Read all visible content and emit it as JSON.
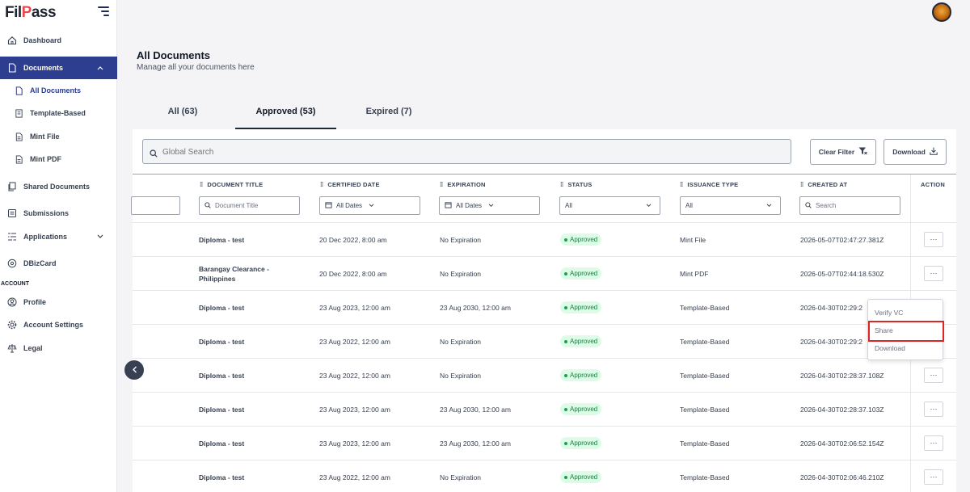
{
  "app": {
    "logo_text_1": "Fil",
    "logo_text_2": "P",
    "logo_text_3": "ass"
  },
  "sidebar": {
    "dashboard": "Dashboard",
    "documents": "Documents",
    "sub": [
      "All Documents",
      "Template-Based",
      "Mint File",
      "Mint PDF"
    ],
    "shared": "Shared Documents",
    "submissions": "Submissions",
    "applications": "Applications",
    "dbizcard": "DBizCard",
    "account_section": "ACCOUNT",
    "profile": "Profile",
    "account_settings": "Account Settings",
    "legal": "Legal"
  },
  "header": {
    "title": "All Documents",
    "subtitle": "Manage all your documents here"
  },
  "tabs": [
    {
      "label": "All (63)"
    },
    {
      "label": "Approved (53)"
    },
    {
      "label": "Expired (7)"
    }
  ],
  "toolbar": {
    "search_placeholder": "Global Search",
    "clear_filter": "Clear Filter",
    "download": "Download"
  },
  "columns": {
    "document_title": "DOCUMENT TITLE",
    "certified_date": "CERTIFIED DATE",
    "expiration": "EXPIRATION",
    "status": "STATUS",
    "issuance_type": "ISSUANCE TYPE",
    "created_at": "CREATED AT",
    "action": "ACTION"
  },
  "filters": {
    "document_title_placeholder": "Document Title",
    "certified_date": "All Dates",
    "expiration": "All Dates",
    "status": "All",
    "issuance_type": "All",
    "created_at_placeholder": "Search"
  },
  "rows": [
    {
      "title": "Diploma - test",
      "certified": "20 Dec 2022, 8:00 am",
      "expiration": "No Expiration",
      "status": "Approved",
      "type": "Mint File",
      "created": "2026-05-07T02:47:27.381Z"
    },
    {
      "title": "Barangay Clearance - Philippines",
      "certified": "20 Dec 2022, 8:00 am",
      "expiration": "No Expiration",
      "status": "Approved",
      "type": "Mint PDF",
      "created": "2026-05-07T02:44:18.530Z"
    },
    {
      "title": "Diploma - test",
      "certified": "23 Aug 2023, 12:00 am",
      "expiration": "23 Aug 2030, 12:00 am",
      "status": "Approved",
      "type": "Template-Based",
      "created": "2026-04-30T02:29:2"
    },
    {
      "title": "Diploma - test",
      "certified": "23 Aug 2022, 12:00 am",
      "expiration": "No Expiration",
      "status": "Approved",
      "type": "Template-Based",
      "created": "2026-04-30T02:29:2"
    },
    {
      "title": "Diploma - test",
      "certified": "23 Aug 2022, 12:00 am",
      "expiration": "No Expiration",
      "status": "Approved",
      "type": "Template-Based",
      "created": "2026-04-30T02:28:37.108Z"
    },
    {
      "title": "Diploma - test",
      "certified": "23 Aug 2023, 12:00 am",
      "expiration": "23 Aug 2030, 12:00 am",
      "status": "Approved",
      "type": "Template-Based",
      "created": "2026-04-30T02:28:37.103Z"
    },
    {
      "title": "Diploma - test",
      "certified": "23 Aug 2023, 12:00 am",
      "expiration": "23 Aug 2030, 12:00 am",
      "status": "Approved",
      "type": "Template-Based",
      "created": "2026-04-30T02:06:52.154Z"
    },
    {
      "title": "Diploma - test",
      "certified": "23 Aug 2022, 12:00 am",
      "expiration": "No Expiration",
      "status": "Approved",
      "type": "Template-Based",
      "created": "2026-04-30T02:06:46.210Z"
    }
  ],
  "action_menu": {
    "items": [
      "Verify VC",
      "Share",
      "Download"
    ],
    "highlighted": "Share"
  },
  "colors": {
    "primary": "#2d3d8f",
    "approved_bg": "#dcfce7",
    "approved_text": "#15803d",
    "highlight": "#dc2626"
  }
}
